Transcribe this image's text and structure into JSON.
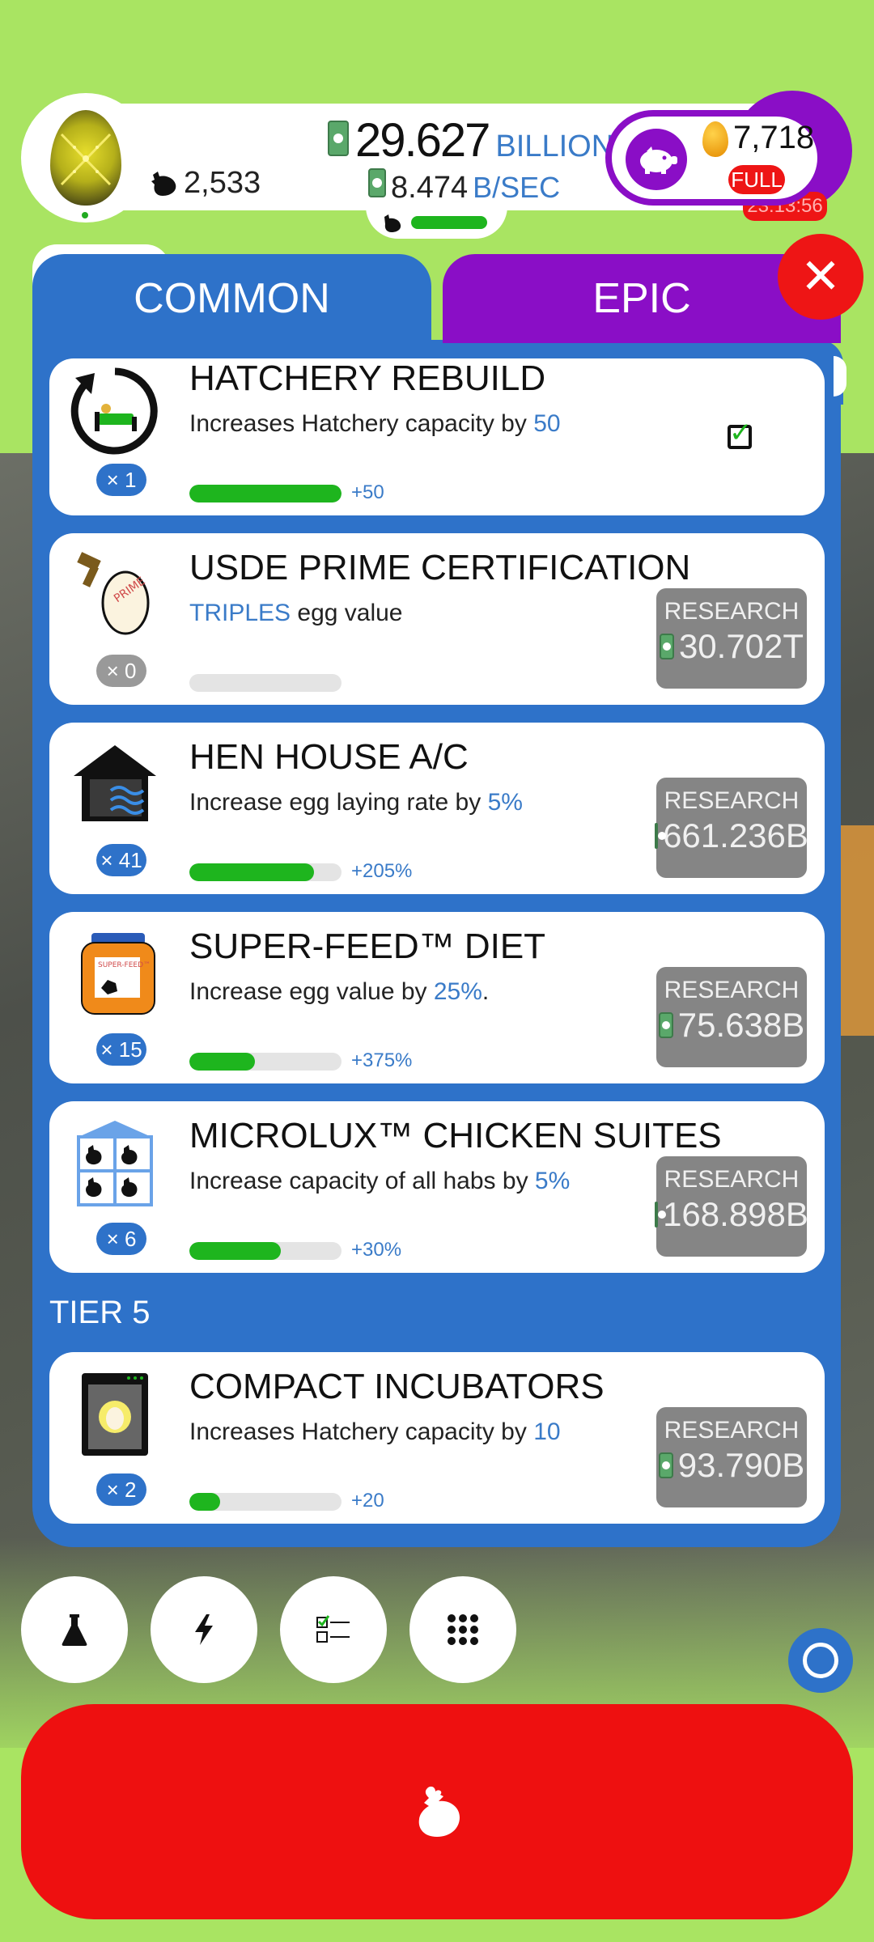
{
  "header": {
    "chicken_count": "2,533",
    "money_value": "29.627",
    "money_unit": "BILLION",
    "rate_value": "8.474",
    "rate_unit": "B/SEC",
    "golden_eggs": "7,718",
    "full_label": "FULL",
    "timer": "23:13:56"
  },
  "tabs": [
    {
      "label": "COMMON",
      "active": true
    },
    {
      "label": "EPIC",
      "active": false
    }
  ],
  "close_icon": "✕",
  "cards": [
    {
      "title": "HATCHERY REBUILD",
      "desc_pre": "Increases Hatchery capacity by ",
      "desc_hl": "50",
      "desc_post": "",
      "count": "× 1",
      "progress": 1.0,
      "bonus": "+50",
      "completed": true
    },
    {
      "title": "USDE PRIME CERTIFICATION",
      "desc_pre": "",
      "desc_hl": "TRIPLES",
      "desc_post": " egg value",
      "count": "× 0",
      "progress": 0.0,
      "bonus": "",
      "research": "RESEARCH",
      "cost": "30.702T"
    },
    {
      "title": "HEN HOUSE A/C",
      "desc_pre": "Increase egg laying rate by ",
      "desc_hl": "5%",
      "desc_post": "",
      "count": "× 41",
      "progress": 0.82,
      "bonus": "+205%",
      "research": "RESEARCH",
      "cost": "661.236B"
    },
    {
      "title": "SUPER-FEED™ DIET",
      "desc_pre": "Increase egg value by ",
      "desc_hl": "25%",
      "desc_post": ".",
      "count": "× 15",
      "progress": 0.43,
      "bonus": "+375%",
      "research": "RESEARCH",
      "cost": "75.638B"
    },
    {
      "title": "MICROLUX™ CHICKEN SUITES",
      "desc_pre": "Increase capacity of all habs by ",
      "desc_hl": "5%",
      "desc_post": "",
      "count": "× 6",
      "progress": 0.6,
      "bonus": "+30%",
      "research": "RESEARCH",
      "cost": "168.898B"
    },
    {
      "title": "COMPACT INCUBATORS",
      "desc_pre": "Increases Hatchery capacity by ",
      "desc_hl": "10",
      "desc_post": "",
      "count": "× 2",
      "progress": 0.2,
      "bonus": "+20",
      "research": "RESEARCH",
      "cost": "93.790B"
    }
  ],
  "tier_label": "TIER 5",
  "bottom_nav": [
    {
      "icon": "flask-icon"
    },
    {
      "icon": "lightning-icon"
    },
    {
      "icon": "checklist-icon"
    },
    {
      "icon": "grid-icon"
    }
  ],
  "hatch_icon": "chicken-icon"
}
